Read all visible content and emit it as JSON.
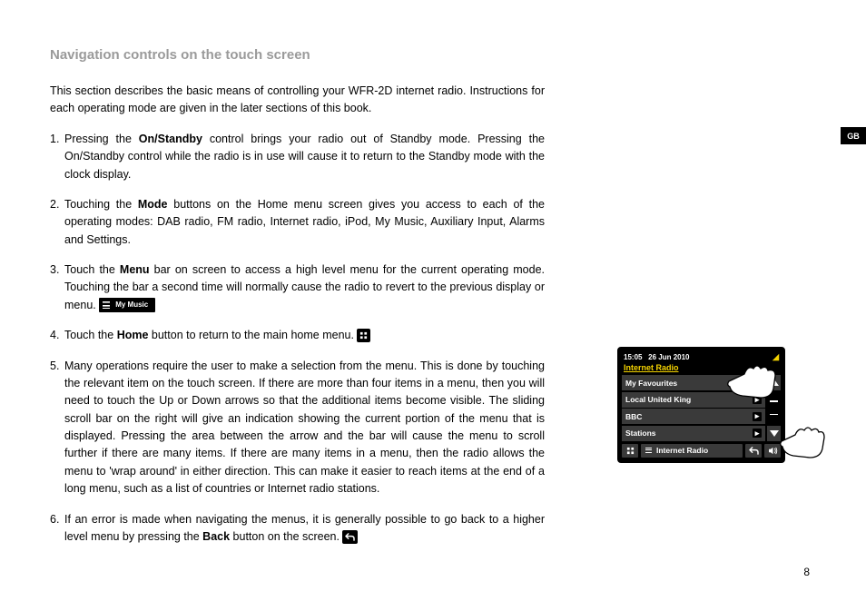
{
  "heading": "Navigation controls on the touch screen",
  "intro": "This section describes the basic means of controlling your WFR-2D internet radio. Instructions for each operating mode are given in the later sections of this book.",
  "steps": {
    "s1": {
      "n": "1.",
      "a": "Pressing the ",
      "bold": "On/Standby",
      "b": " control brings your radio out of Standby mode. Pressing the On/Standby control while the radio is in use will cause it to return to the Standby mode with the clock display."
    },
    "s2": {
      "n": "2.",
      "a": "Touching the ",
      "bold": "Mode",
      "b": " buttons on the Home menu screen gives you access to each of the operating modes: DAB radio, FM radio, Internet radio, iPod, My Music, Auxiliary Input, Alarms and Settings."
    },
    "s3": {
      "n": "3.",
      "a": "Touch the ",
      "bold": "Menu",
      "b": " bar on screen to access a high level menu for the current operating mode. Touching the bar a second time will normally cause the radio to revert to the previous display or menu. ",
      "chip": "My Music"
    },
    "s4": {
      "n": "4.",
      "a": "Touch the ",
      "bold": "Home",
      "b": " button to return to the main home menu. "
    },
    "s5": {
      "n": "5.",
      "t": "Many operations require the user to make a selection from the menu. This is done by touching the relevant item on the touch screen.  If there are more than four items in a menu, then you will need to touch the Up or Down arrows so that the additional items become visible. The sliding scroll bar on the right will give an indication showing the current portion of the menu that is displayed. Pressing the area between the arrow and the bar will cause the menu to scroll further if there are many items. If there are many items in a menu, then the radio allows the menu to 'wrap around' in either direction. This can make it easier to reach items at the end of a long menu, such as a list of countries or Internet radio stations."
    },
    "s6": {
      "n": "6.",
      "a": "If an error is made when navigating the menus, it is generally possible to go back to a higher level menu by pressing the ",
      "bold": "Back",
      "b": " button on the screen. "
    }
  },
  "sidebar_tab": "GB",
  "page_number": "8",
  "device": {
    "time": "15:05",
    "date": "26 Jun 2010",
    "title": "Internet Radio",
    "items": [
      "My Favourites",
      "Local United King",
      "BBC",
      "Stations"
    ],
    "bottom_label": "Internet Radio"
  }
}
